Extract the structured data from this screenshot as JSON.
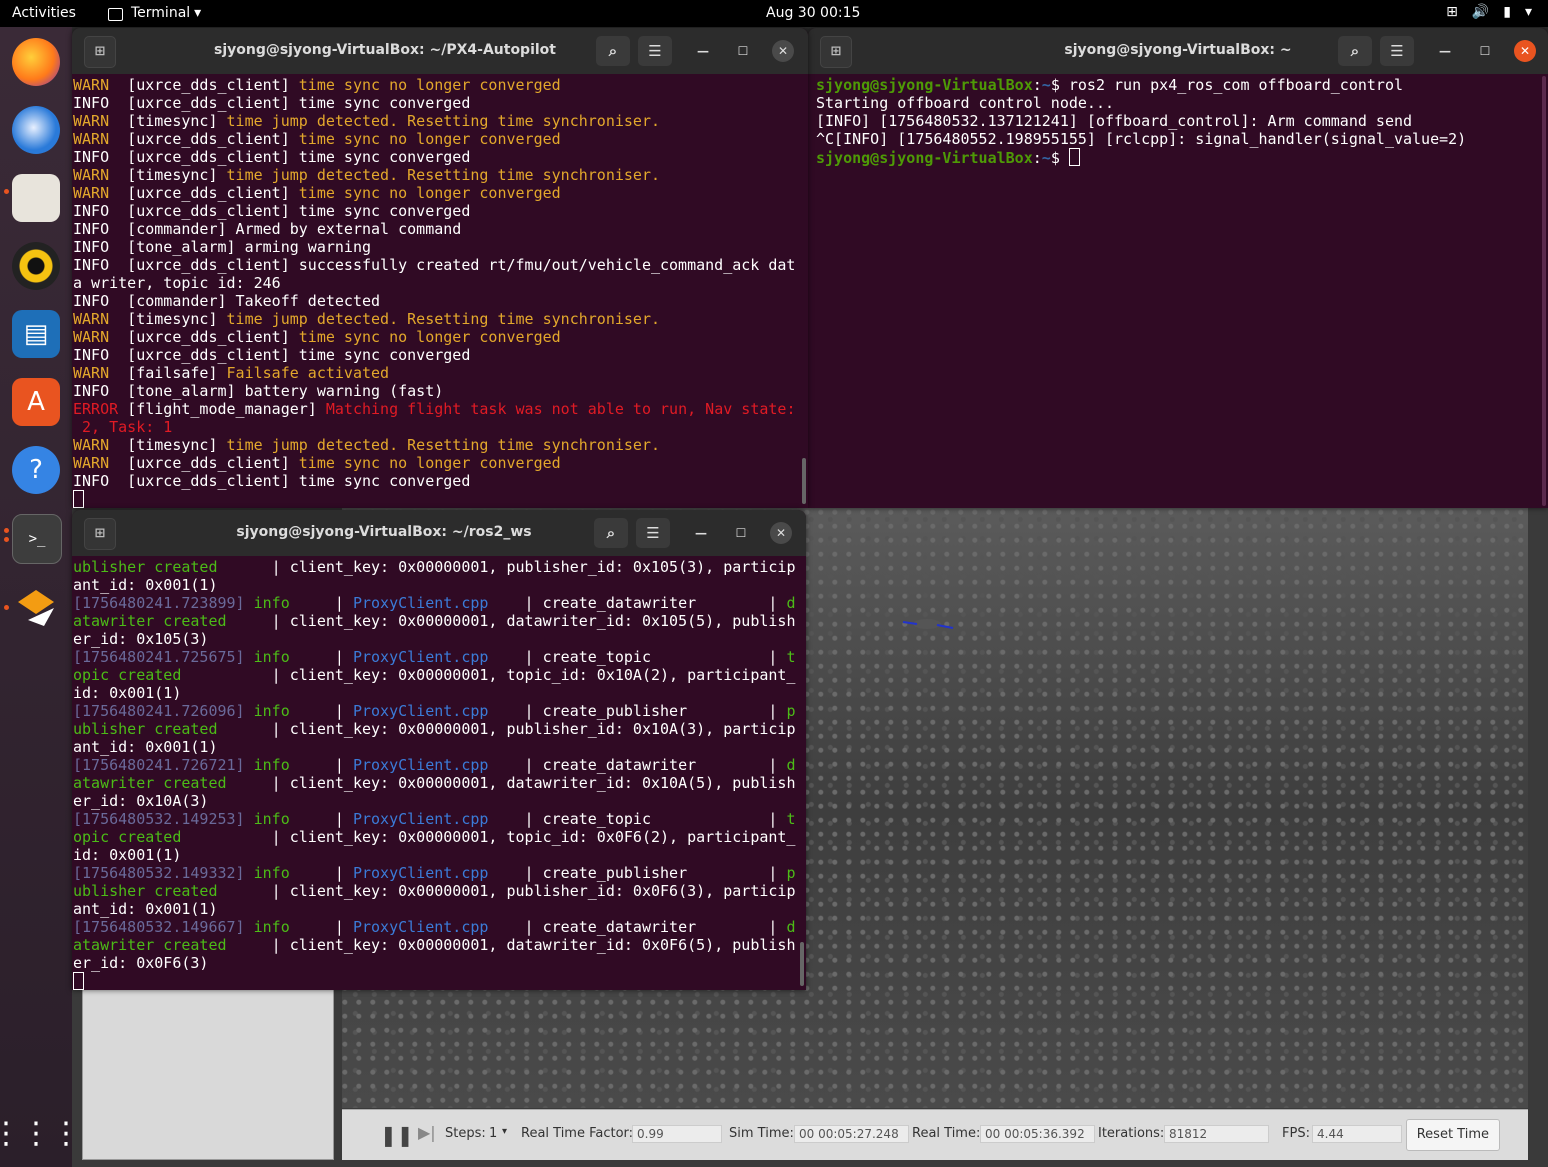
{
  "topbar": {
    "activities": "Activities",
    "app_name": "Terminal",
    "clock": "Aug 30  00:15"
  },
  "dock": {
    "items": [
      "firefox-icon",
      "thunderbird-icon",
      "files-icon",
      "rhythmbox-icon",
      "libreoffice-writer-icon",
      "app-center-icon",
      "help-icon",
      "terminal-icon",
      "qgroundcontrol-icon"
    ],
    "show_apps_icon": "grid-icon"
  },
  "win1": {
    "title": "sjyong@sjyong-VirtualBox: ~/PX4-Autopilot",
    "lines": [
      [
        {
          "t": "WARN  ",
          "c": "c-warn"
        },
        {
          "t": "[uxrce_dds_client] "
        },
        {
          "t": "time sync no longer converged",
          "c": "c-warn"
        }
      ],
      [
        {
          "t": "INFO  [uxrce_dds_client] time sync converged"
        }
      ],
      [
        {
          "t": "WARN  ",
          "c": "c-warn"
        },
        {
          "t": "[timesync] "
        },
        {
          "t": "time jump detected. Resetting time synchroniser.",
          "c": "c-warn"
        }
      ],
      [
        {
          "t": "WARN  ",
          "c": "c-warn"
        },
        {
          "t": "[uxrce_dds_client] "
        },
        {
          "t": "time sync no longer converged",
          "c": "c-warn"
        }
      ],
      [
        {
          "t": "INFO  [uxrce_dds_client] time sync converged"
        }
      ],
      [
        {
          "t": "WARN  ",
          "c": "c-warn"
        },
        {
          "t": "[timesync] "
        },
        {
          "t": "time jump detected. Resetting time synchroniser.",
          "c": "c-warn"
        }
      ],
      [
        {
          "t": "WARN  ",
          "c": "c-warn"
        },
        {
          "t": "[uxrce_dds_client] "
        },
        {
          "t": "time sync no longer converged",
          "c": "c-warn"
        }
      ],
      [
        {
          "t": "INFO  [uxrce_dds_client] time sync converged"
        }
      ],
      [
        {
          "t": "INFO  [commander] Armed by external command"
        }
      ],
      [
        {
          "t": "INFO  [tone_alarm] arming warning"
        }
      ],
      [
        {
          "t": "INFO  [uxrce_dds_client] successfully created rt/fmu/out/vehicle_command_ack dat"
        }
      ],
      [
        {
          "t": "a writer, topic id: 246"
        }
      ],
      [
        {
          "t": "INFO  [commander] Takeoff detected"
        }
      ],
      [
        {
          "t": "WARN  ",
          "c": "c-warn"
        },
        {
          "t": "[timesync] "
        },
        {
          "t": "time jump detected. Resetting time synchroniser.",
          "c": "c-warn"
        }
      ],
      [
        {
          "t": "WARN  ",
          "c": "c-warn"
        },
        {
          "t": "[uxrce_dds_client] "
        },
        {
          "t": "time sync no longer converged",
          "c": "c-warn"
        }
      ],
      [
        {
          "t": "INFO  [uxrce_dds_client] time sync converged"
        }
      ],
      [
        {
          "t": "WARN  ",
          "c": "c-warn"
        },
        {
          "t": "[failsafe] "
        },
        {
          "t": "Failsafe activated",
          "c": "c-warn"
        }
      ],
      [
        {
          "t": "INFO  [tone_alarm] battery warning (fast)"
        }
      ],
      [
        {
          "t": "ERROR ",
          "c": "c-err"
        },
        {
          "t": "[flight_mode_manager] "
        },
        {
          "t": "Matching flight task was not able to run, Nav state:",
          "c": "c-err"
        }
      ],
      [
        {
          "t": " 2, Task: 1",
          "c": "c-err"
        }
      ],
      [
        {
          "t": "WARN  ",
          "c": "c-warn"
        },
        {
          "t": "[timesync] "
        },
        {
          "t": "time jump detected. Resetting time synchroniser.",
          "c": "c-warn"
        }
      ],
      [
        {
          "t": "WARN  ",
          "c": "c-warn"
        },
        {
          "t": "[uxrce_dds_client] "
        },
        {
          "t": "time sync no longer converged",
          "c": "c-warn"
        }
      ],
      [
        {
          "t": "INFO  [uxrce_dds_client] time sync converged"
        }
      ]
    ]
  },
  "win2": {
    "title": "sjyong@sjyong-VirtualBox: ~",
    "lines": [
      [
        {
          "t": "sjyong@sjyong-VirtualBox",
          "c": "c-prompt"
        },
        {
          "t": ":"
        },
        {
          "t": "~",
          "c": "c-path"
        },
        {
          "t": "$ ros2 run px4_ros_com offboard_control"
        }
      ],
      [
        {
          "t": "Starting offboard control node..."
        }
      ],
      [
        {
          "t": "[INFO] [1756480532.137121241] [offboard_control]: Arm command send"
        }
      ],
      [
        {
          "t": "^C[INFO] [1756480552.198955155] [rclcpp]: signal_handler(signal_value=2)"
        }
      ],
      [
        {
          "t": "sjyong@sjyong-VirtualBox",
          "c": "c-prompt"
        },
        {
          "t": ":"
        },
        {
          "t": "~",
          "c": "c-path"
        },
        {
          "t": "$ "
        }
      ]
    ]
  },
  "win3": {
    "title": "sjyong@sjyong-VirtualBox: ~/ros2_ws",
    "lines": [
      [
        {
          "t": "ublisher created",
          "c": "c-grn"
        },
        {
          "t": "      | client_key: 0x00000001, publisher_id: 0x105(3), particip"
        }
      ],
      [
        {
          "t": "ant_id: 0x001(1)"
        }
      ],
      [
        {
          "t": "[1756480241.723899]",
          "c": "c-dim"
        },
        {
          "t": " "
        },
        {
          "t": "info",
          "c": "c-grn"
        },
        {
          "t": "     | "
        },
        {
          "t": "ProxyClient.cpp",
          "c": "c-blue"
        },
        {
          "t": "    | create_datawriter        | "
        },
        {
          "t": "d",
          "c": "c-grn"
        }
      ],
      [
        {
          "t": "atawriter created",
          "c": "c-grn"
        },
        {
          "t": "     | client_key: 0x00000001, datawriter_id: 0x105(5), publish"
        }
      ],
      [
        {
          "t": "er_id: 0x105(3)"
        }
      ],
      [
        {
          "t": "[1756480241.725675]",
          "c": "c-dim"
        },
        {
          "t": " "
        },
        {
          "t": "info",
          "c": "c-grn"
        },
        {
          "t": "     | "
        },
        {
          "t": "ProxyClient.cpp",
          "c": "c-blue"
        },
        {
          "t": "    | create_topic             | "
        },
        {
          "t": "t",
          "c": "c-grn"
        }
      ],
      [
        {
          "t": "opic created",
          "c": "c-grn"
        },
        {
          "t": "          | client_key: 0x00000001, topic_id: 0x10A(2), participant_"
        }
      ],
      [
        {
          "t": "id: 0x001(1)"
        }
      ],
      [
        {
          "t": "[1756480241.726096]",
          "c": "c-dim"
        },
        {
          "t": " "
        },
        {
          "t": "info",
          "c": "c-grn"
        },
        {
          "t": "     | "
        },
        {
          "t": "ProxyClient.cpp",
          "c": "c-blue"
        },
        {
          "t": "    | create_publisher         | "
        },
        {
          "t": "p",
          "c": "c-grn"
        }
      ],
      [
        {
          "t": "ublisher created",
          "c": "c-grn"
        },
        {
          "t": "      | client_key: 0x00000001, publisher_id: 0x10A(3), particip"
        }
      ],
      [
        {
          "t": "ant_id: 0x001(1)"
        }
      ],
      [
        {
          "t": "[1756480241.726721]",
          "c": "c-dim"
        },
        {
          "t": " "
        },
        {
          "t": "info",
          "c": "c-grn"
        },
        {
          "t": "     | "
        },
        {
          "t": "ProxyClient.cpp",
          "c": "c-blue"
        },
        {
          "t": "    | create_datawriter        | "
        },
        {
          "t": "d",
          "c": "c-grn"
        }
      ],
      [
        {
          "t": "atawriter created",
          "c": "c-grn"
        },
        {
          "t": "     | client_key: 0x00000001, datawriter_id: 0x10A(5), publish"
        }
      ],
      [
        {
          "t": "er_id: 0x10A(3)"
        }
      ],
      [
        {
          "t": "[1756480532.149253]",
          "c": "c-dim"
        },
        {
          "t": " "
        },
        {
          "t": "info",
          "c": "c-grn"
        },
        {
          "t": "     | "
        },
        {
          "t": "ProxyClient.cpp",
          "c": "c-blue"
        },
        {
          "t": "    | create_topic             | "
        },
        {
          "t": "t",
          "c": "c-grn"
        }
      ],
      [
        {
          "t": "opic created",
          "c": "c-grn"
        },
        {
          "t": "          | client_key: 0x00000001, topic_id: 0x0F6(2), participant_"
        }
      ],
      [
        {
          "t": "id: 0x001(1)"
        }
      ],
      [
        {
          "t": "[1756480532.149332]",
          "c": "c-dim"
        },
        {
          "t": " "
        },
        {
          "t": "info",
          "c": "c-grn"
        },
        {
          "t": "     | "
        },
        {
          "t": "ProxyClient.cpp",
          "c": "c-blue"
        },
        {
          "t": "    | create_publisher         | "
        },
        {
          "t": "p",
          "c": "c-grn"
        }
      ],
      [
        {
          "t": "ublisher created",
          "c": "c-grn"
        },
        {
          "t": "      | client_key: 0x00000001, publisher_id: 0x0F6(3), particip"
        }
      ],
      [
        {
          "t": "ant_id: 0x001(1)"
        }
      ],
      [
        {
          "t": "[1756480532.149667]",
          "c": "c-dim"
        },
        {
          "t": " "
        },
        {
          "t": "info",
          "c": "c-grn"
        },
        {
          "t": "     | "
        },
        {
          "t": "ProxyClient.cpp",
          "c": "c-blue"
        },
        {
          "t": "    | create_datawriter        | "
        },
        {
          "t": "d",
          "c": "c-grn"
        }
      ],
      [
        {
          "t": "atawriter created",
          "c": "c-grn"
        },
        {
          "t": "     | client_key: 0x00000001, datawriter_id: 0x0F6(5), publish"
        }
      ],
      [
        {
          "t": "er_id: 0x0F6(3)"
        }
      ]
    ]
  },
  "gazebo": {
    "steps_label": "Steps:",
    "steps_value": "1",
    "rtf_label": "Real Time Factor:",
    "rtf_value": "0.99",
    "sim_label": "Sim Time:",
    "sim_value": "00 00:05:27.248",
    "real_label": "Real Time:",
    "real_value": "00 00:05:36.392",
    "iter_label": "Iterations:",
    "iter_value": "81812",
    "fps_label": "FPS:",
    "fps_value": "4.44",
    "reset_label": "Reset Time"
  }
}
